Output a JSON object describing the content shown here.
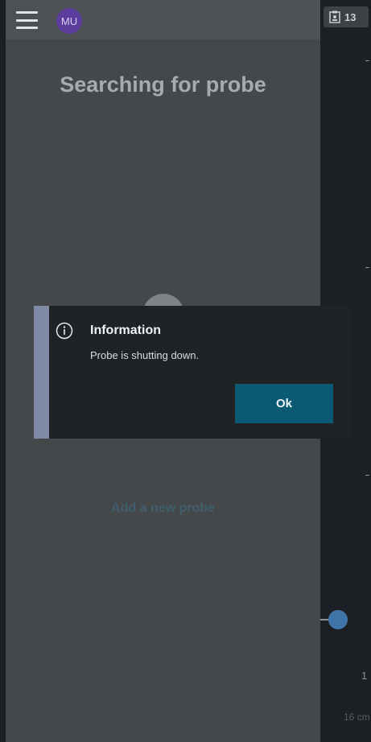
{
  "drawer": {
    "avatar_initials": "MU",
    "status_title": "Searching for probe",
    "add_probe_label": "Add a new probe"
  },
  "imaging": {
    "exam_count": "13",
    "scale_mark": "1",
    "depth_label": "16 cm"
  },
  "dialog": {
    "title": "Information",
    "message": "Probe is shutting down.",
    "ok_label": "Ok"
  },
  "colors": {
    "accent_button": "#0b5a73",
    "dialog_bar": "#7f8aa7",
    "avatar": "#5c3d9e",
    "depth_knob": "#3f74a8"
  },
  "icons": [
    "menu-icon",
    "clipboard-user-icon",
    "info-icon"
  ]
}
